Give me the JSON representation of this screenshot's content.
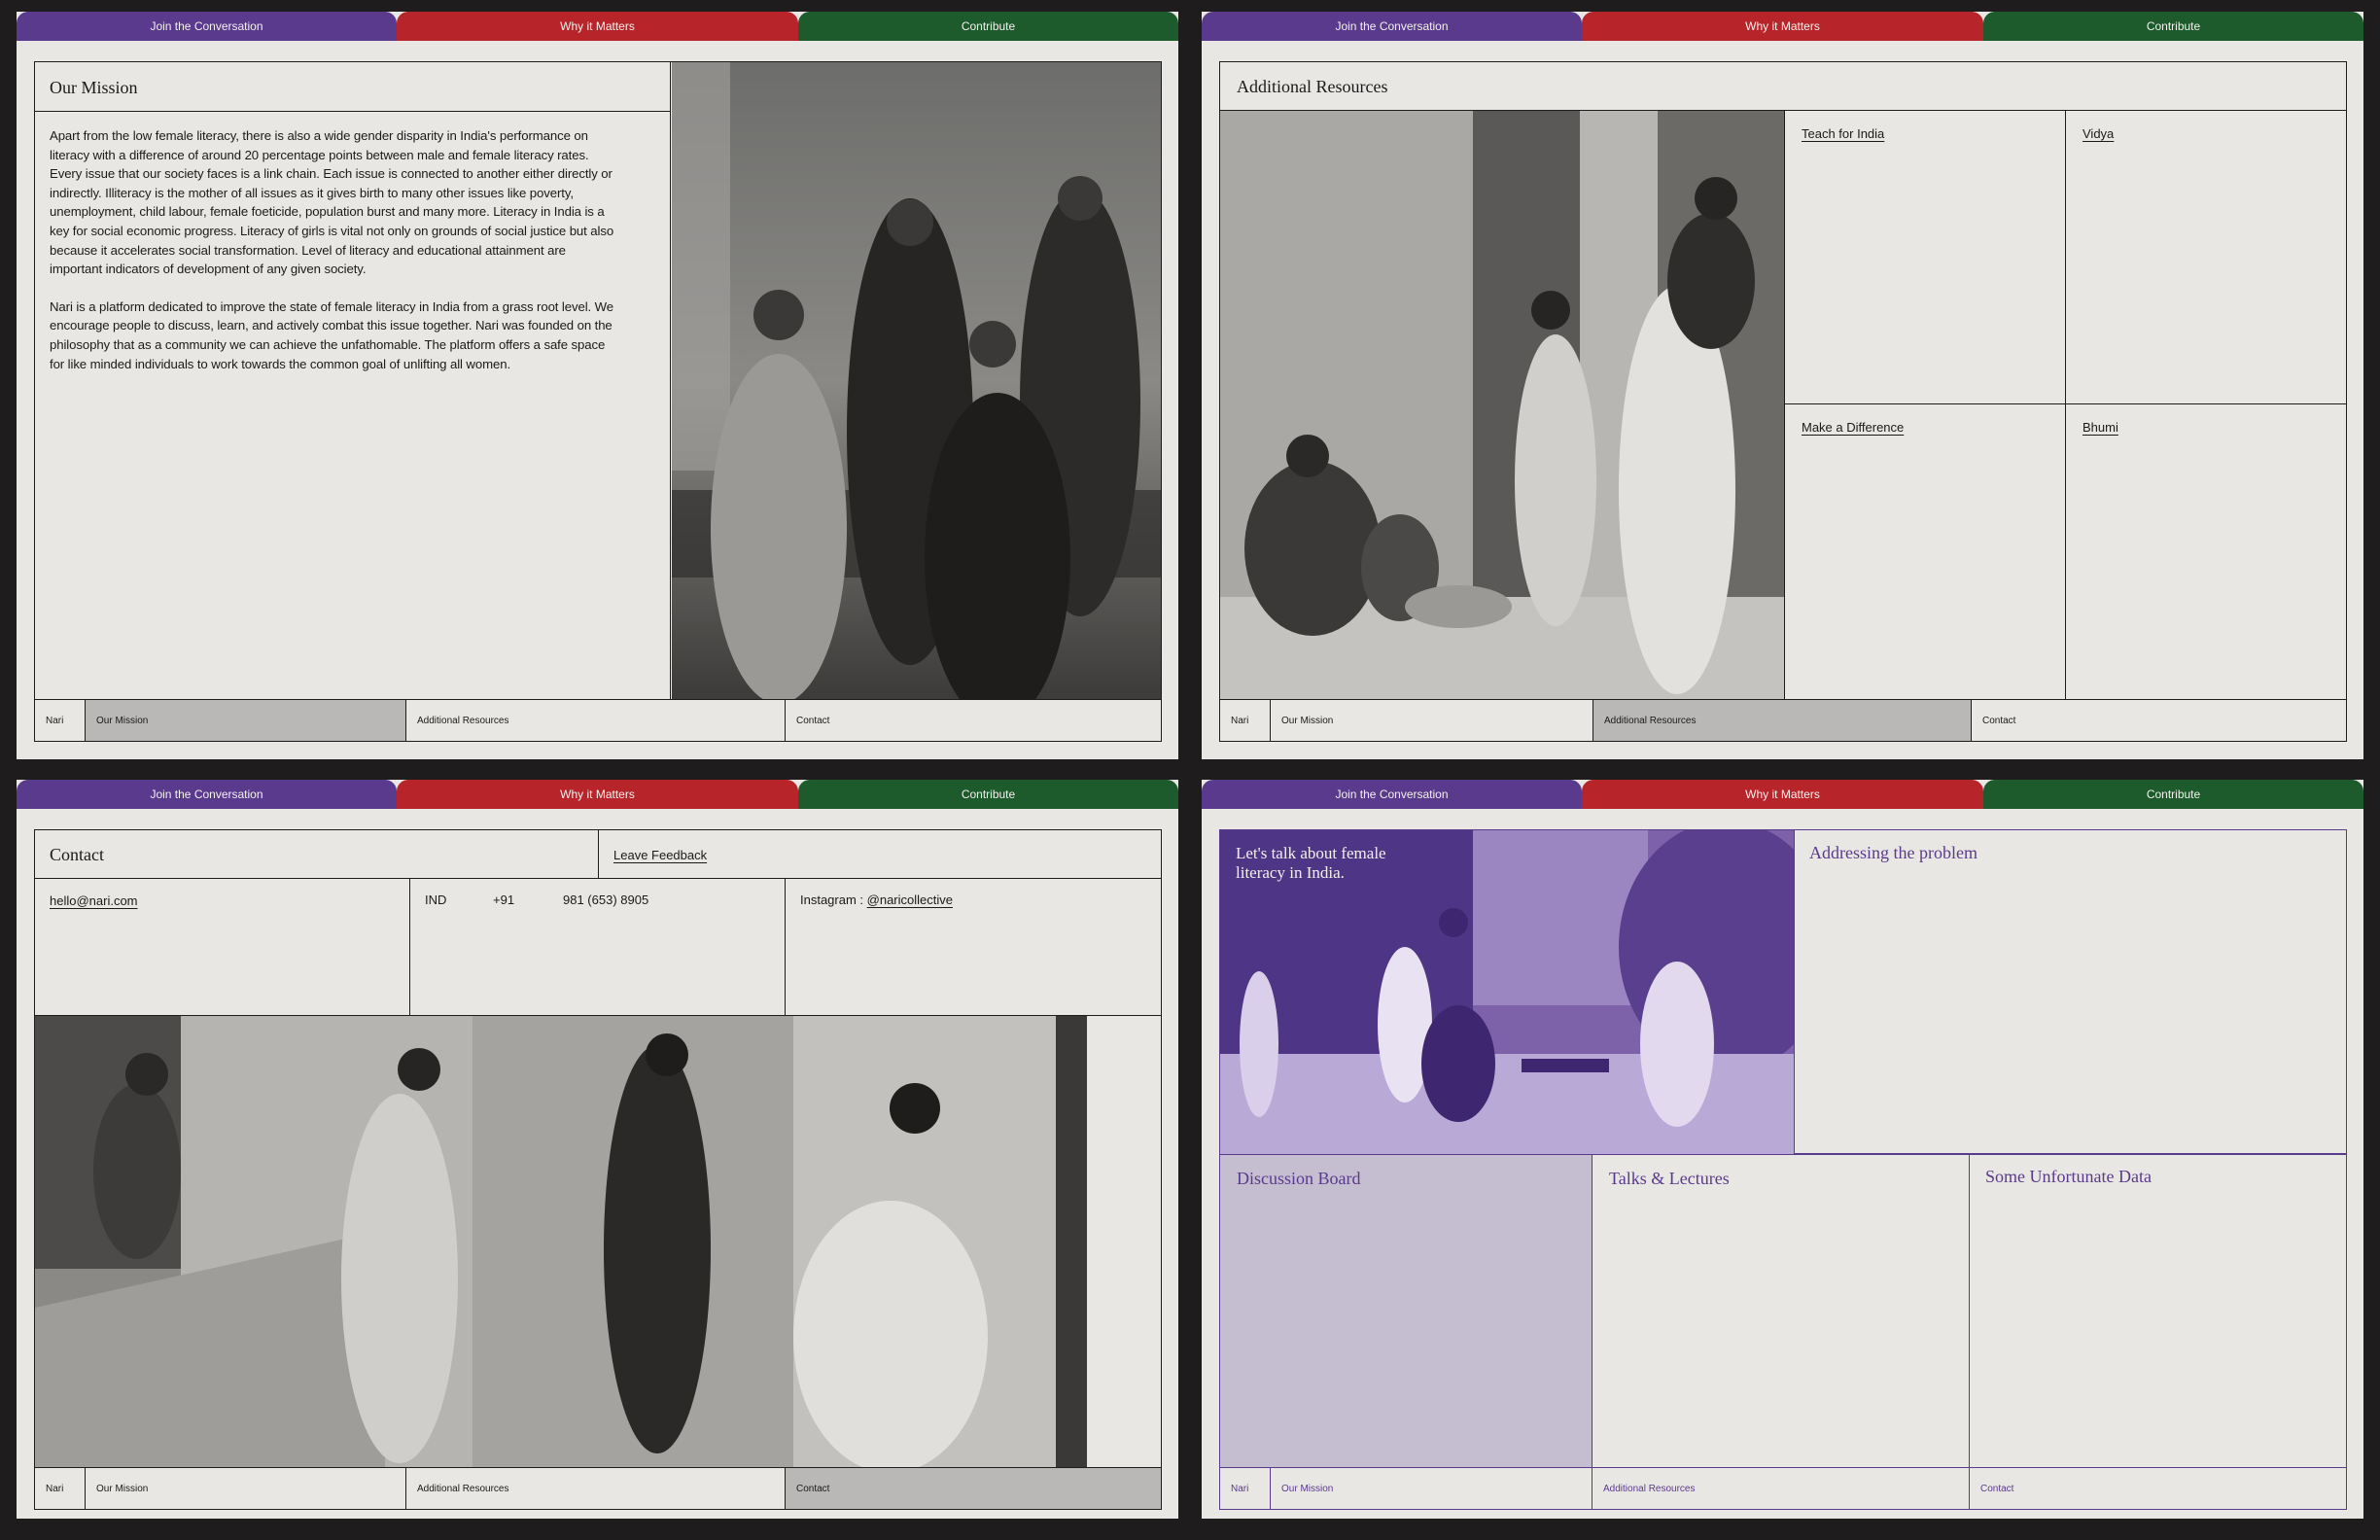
{
  "nav": {
    "tab1": "Join the Conversation",
    "tab2": "Why it Matters",
    "tab3": "Contribute"
  },
  "footer": {
    "brand": "Nari",
    "mission": "Our Mission",
    "resources": "Additional Resources",
    "contact": "Contact"
  },
  "mission": {
    "title": "Our Mission",
    "p1": "Apart from the low female literacy, there is also a wide gender disparity in India's performance on literacy with a difference of around 20 percentage points between male and female literacy rates. Every issue that our society faces is a link chain. Each issue is connected to another either directly or indirectly. Illiteracy is the mother of all issues as it gives birth to many other issues like poverty, unemployment, child labour, female foeticide, population burst and many more. Literacy in India is a key for social economic progress. Literacy of girls is vital not only on grounds of social justice but also because it accelerates social transformation. Level of literacy and educational attainment are important indicators of development of any given society.",
    "p2": "Nari is a platform dedicated to improve the state of female literacy in India from a grass root level. We encourage people to discuss, learn, and actively combat this issue together. Nari was founded on the philosophy that as a community we can achieve the unfathomable. The platform offers a safe space for like minded individuals to work towards the common goal of unlifting all women."
  },
  "resources": {
    "title": "Additional Resources",
    "links": [
      "Teach for India",
      "Vidya",
      "Make a Difference",
      "Bhumi"
    ]
  },
  "contact": {
    "title": "Contact",
    "feedback": "Leave Feedback",
    "email": "hello@nari.com",
    "country": "IND",
    "code": "+91",
    "phone": "981 (653) 8905",
    "instagram_label": "Instagram : ",
    "instagram_handle": "@naricollective"
  },
  "home": {
    "hero_text": "Let's talk about female literacy in India.",
    "addressing": "Addressing the problem",
    "discussion": "Discussion Board",
    "talks": "Talks & Lectures",
    "data": "Some Unfortunate Data"
  },
  "colors": {
    "purple": "#5a3a8c",
    "red": "#b7252b",
    "green": "#1d5a2c",
    "paper": "#e9e7e3",
    "ink": "#1f1c1d"
  }
}
